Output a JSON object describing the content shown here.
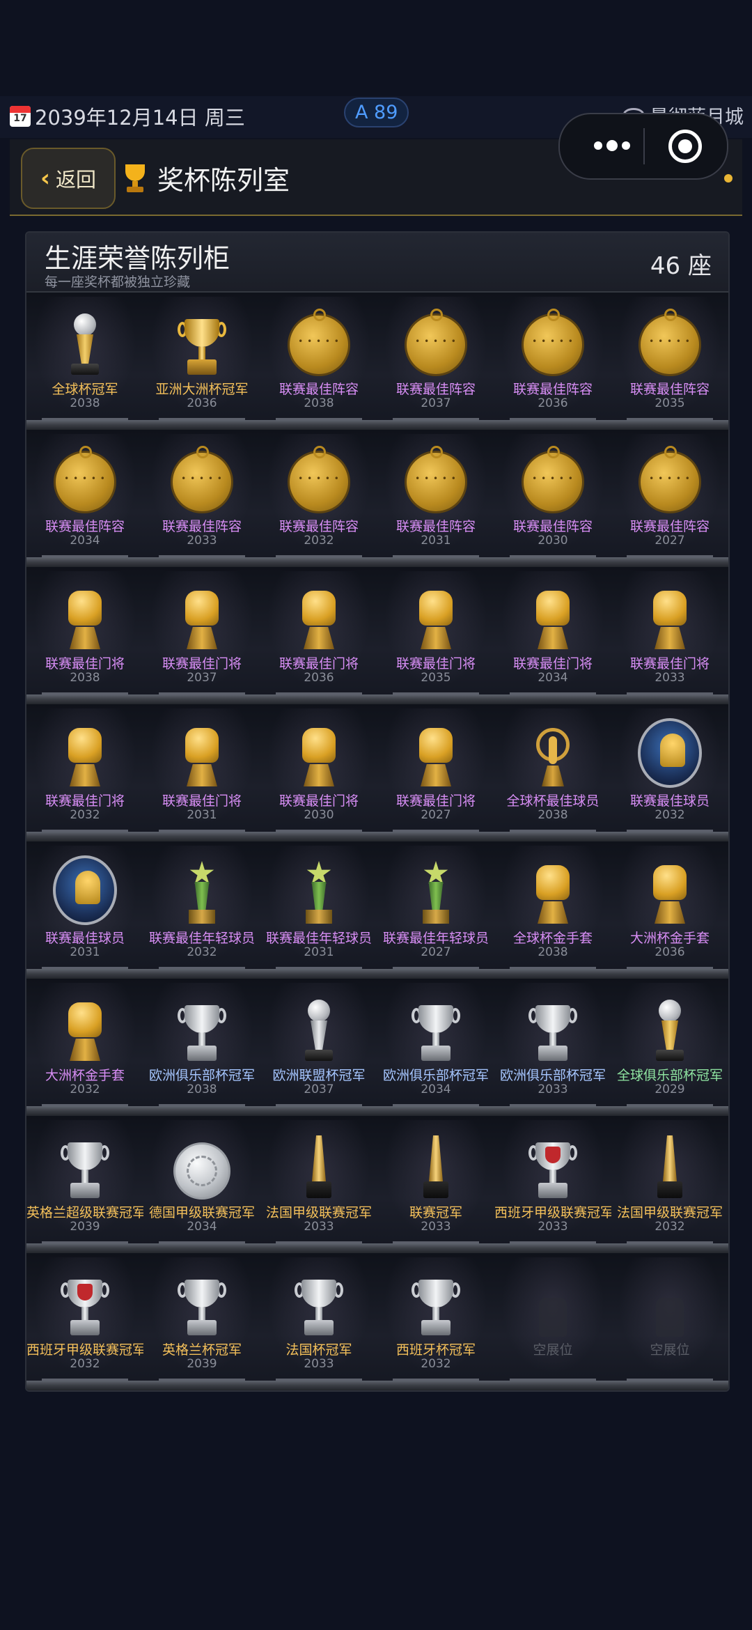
{
  "status": {
    "date": "2039年12月14日 周三",
    "calendar_day": "17",
    "rating": "A 89",
    "team": "曼彻蓝月城"
  },
  "header": {
    "back_label": "返回",
    "title": "奖杯陈列室"
  },
  "cabinet": {
    "title": "生涯荣誉陈列柜",
    "subtitle": "每一座奖杯都被独立珍藏",
    "count": "46 座"
  },
  "shelves": [
    [
      {
        "name": "全球杯冠军",
        "year": "2038",
        "color": "gold",
        "icon": "globe-trophy"
      },
      {
        "name": "亚洲大洲杯冠军",
        "year": "2036",
        "color": "gold",
        "icon": "gold-cup"
      },
      {
        "name": "联赛最佳阵容",
        "year": "2038",
        "color": "purple",
        "icon": "gold-medal"
      },
      {
        "name": "联赛最佳阵容",
        "year": "2037",
        "color": "purple",
        "icon": "gold-medal"
      },
      {
        "name": "联赛最佳阵容",
        "year": "2036",
        "color": "purple",
        "icon": "gold-medal"
      },
      {
        "name": "联赛最佳阵容",
        "year": "2035",
        "color": "purple",
        "icon": "gold-medal"
      }
    ],
    [
      {
        "name": "联赛最佳阵容",
        "year": "2034",
        "color": "purple",
        "icon": "gold-medal"
      },
      {
        "name": "联赛最佳阵容",
        "year": "2033",
        "color": "purple",
        "icon": "gold-medal"
      },
      {
        "name": "联赛最佳阵容",
        "year": "2032",
        "color": "purple",
        "icon": "gold-medal"
      },
      {
        "name": "联赛最佳阵容",
        "year": "2031",
        "color": "purple",
        "icon": "gold-medal"
      },
      {
        "name": "联赛最佳阵容",
        "year": "2030",
        "color": "purple",
        "icon": "gold-medal"
      },
      {
        "name": "联赛最佳阵容",
        "year": "2027",
        "color": "purple",
        "icon": "gold-medal"
      }
    ],
    [
      {
        "name": "联赛最佳门将",
        "year": "2038",
        "color": "purple",
        "icon": "golden-glove"
      },
      {
        "name": "联赛最佳门将",
        "year": "2037",
        "color": "purple",
        "icon": "golden-glove"
      },
      {
        "name": "联赛最佳门将",
        "year": "2036",
        "color": "purple",
        "icon": "golden-glove"
      },
      {
        "name": "联赛最佳门将",
        "year": "2035",
        "color": "purple",
        "icon": "golden-glove"
      },
      {
        "name": "联赛最佳门将",
        "year": "2034",
        "color": "purple",
        "icon": "golden-glove"
      },
      {
        "name": "联赛最佳门将",
        "year": "2033",
        "color": "purple",
        "icon": "golden-glove"
      }
    ],
    [
      {
        "name": "联赛最佳门将",
        "year": "2032",
        "color": "purple",
        "icon": "golden-glove"
      },
      {
        "name": "联赛最佳门将",
        "year": "2031",
        "color": "purple",
        "icon": "golden-glove"
      },
      {
        "name": "联赛最佳门将",
        "year": "2030",
        "color": "purple",
        "icon": "golden-glove"
      },
      {
        "name": "联赛最佳门将",
        "year": "2027",
        "color": "purple",
        "icon": "golden-glove"
      },
      {
        "name": "全球杯最佳球员",
        "year": "2038",
        "color": "purple",
        "icon": "ring-trophy"
      },
      {
        "name": "联赛最佳球员",
        "year": "2032",
        "color": "purple",
        "icon": "player-badge"
      }
    ],
    [
      {
        "name": "联赛最佳球员",
        "year": "2031",
        "color": "purple",
        "icon": "player-badge"
      },
      {
        "name": "联赛最佳年轻球员",
        "year": "2032",
        "color": "purple",
        "icon": "star-trophy"
      },
      {
        "name": "联赛最佳年轻球员",
        "year": "2031",
        "color": "purple",
        "icon": "star-trophy"
      },
      {
        "name": "联赛最佳年轻球员",
        "year": "2027",
        "color": "purple",
        "icon": "star-trophy"
      },
      {
        "name": "全球杯金手套",
        "year": "2038",
        "color": "purple",
        "icon": "golden-glove"
      },
      {
        "name": "大洲杯金手套",
        "year": "2036",
        "color": "purple",
        "icon": "golden-glove"
      }
    ],
    [
      {
        "name": "大洲杯金手套",
        "year": "2032",
        "color": "purple",
        "icon": "golden-glove"
      },
      {
        "name": "欧洲俱乐部杯冠军",
        "year": "2038",
        "color": "blue",
        "icon": "silver-cup"
      },
      {
        "name": "欧洲联盟杯冠军",
        "year": "2037",
        "color": "blue",
        "icon": "silver-globe-trophy"
      },
      {
        "name": "欧洲俱乐部杯冠军",
        "year": "2034",
        "color": "blue",
        "icon": "silver-cup"
      },
      {
        "name": "欧洲俱乐部杯冠军",
        "year": "2033",
        "color": "blue",
        "icon": "silver-cup"
      },
      {
        "name": "全球俱乐部杯冠军",
        "year": "2029",
        "color": "green",
        "icon": "globe-trophy"
      }
    ],
    [
      {
        "name": "英格兰超级联赛冠军",
        "year": "2039",
        "color": "gold",
        "icon": "silver-cup"
      },
      {
        "name": "德国甲级联赛冠军",
        "year": "2034",
        "color": "gold",
        "icon": "silver-plate"
      },
      {
        "name": "法国甲级联赛冠军",
        "year": "2033",
        "color": "gold",
        "icon": "spire-trophy"
      },
      {
        "name": "联赛冠军",
        "year": "2033",
        "color": "gold",
        "icon": "spire-trophy"
      },
      {
        "name": "西班牙甲级联赛冠军",
        "year": "2033",
        "color": "gold",
        "icon": "red-cup"
      },
      {
        "name": "法国甲级联赛冠军",
        "year": "2032",
        "color": "gold",
        "icon": "spire-trophy"
      }
    ],
    [
      {
        "name": "西班牙甲级联赛冠军",
        "year": "2032",
        "color": "gold",
        "icon": "red-cup"
      },
      {
        "name": "英格兰杯冠军",
        "year": "2039",
        "color": "gold",
        "icon": "silver-cup"
      },
      {
        "name": "法国杯冠军",
        "year": "2033",
        "color": "gold",
        "icon": "silver-cup"
      },
      {
        "name": "西班牙杯冠军",
        "year": "2032",
        "color": "gold",
        "icon": "silver-cup"
      },
      {
        "name": "空展位",
        "year": "",
        "color": "dim",
        "icon": "empty-slot"
      },
      {
        "name": "空展位",
        "year": "",
        "color": "dim",
        "icon": "empty-slot"
      }
    ]
  ]
}
